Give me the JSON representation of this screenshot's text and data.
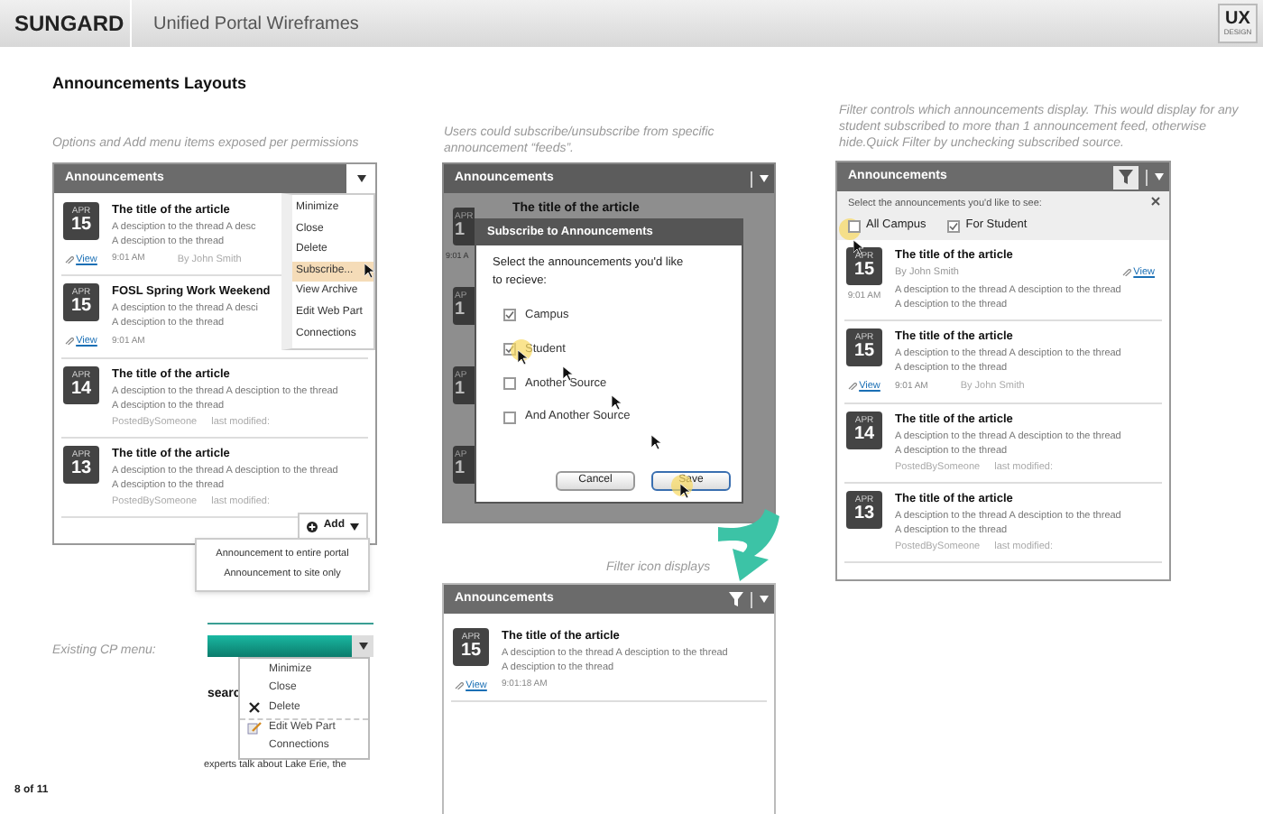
{
  "header": {
    "brand": "SUNGARD",
    "title": "Unified Portal Wireframes",
    "logo": "UX",
    "logo_sub": "DESIGN"
  },
  "page_title": "Announcements Layouts",
  "panel_options": {
    "caption": "Options and Add menu items exposed per permissions",
    "portlet_title": "Announcements",
    "articles": [
      {
        "kind": "footer",
        "month": "APR",
        "day": "15",
        "title": "The title of the article",
        "lines": [
          "A desciption to the thread A desc",
          "A desciption to the thread"
        ],
        "view": "View",
        "time": "9:01 AM",
        "author": "By John Smith"
      },
      {
        "kind": "footer",
        "month": "APR",
        "day": "15",
        "title": "FOSL Spring Work Weekend",
        "lines": [
          "A desciption to the thread A desci",
          "A desciption to the thread"
        ],
        "view": "View",
        "time": "9:01 AM"
      },
      {
        "kind": "footer",
        "month": "APR",
        "day": "14",
        "title": "The title of the article",
        "lines": [
          "A desciption to the thread A desciption to the thread",
          "A desciption to the thread"
        ],
        "posted_by": "PostedBySomeone",
        "last_modified": "last modified:"
      },
      {
        "kind": "footer",
        "month": "APR",
        "day": "13",
        "title": "The title of the article",
        "lines": [
          "A desciption to the thread A desciption to the thread",
          "A desciption to the thread"
        ],
        "posted_by": "PostedBySomeone",
        "last_modified": "last modified:"
      }
    ],
    "menu": [
      {
        "label": "Minimize",
        "selected": false
      },
      {
        "label": "Close",
        "selected": false
      },
      {
        "label": "Delete",
        "selected": false
      },
      {
        "label": "Subscribe...",
        "selected": true
      },
      {
        "label": "View Archive",
        "selected": false
      },
      {
        "label": "Edit Web Part",
        "selected": false
      },
      {
        "label": "Connections",
        "selected": false
      }
    ],
    "add_button": "Add",
    "add_menu": [
      "Announcement to entire portal",
      "Announcement to site only"
    ]
  },
  "cp_menu": {
    "caption": "Existing CP menu:",
    "items": [
      {
        "label": "Minimize",
        "kind": "plain",
        "separator_before": false
      },
      {
        "label": "Close",
        "kind": "plain",
        "separator_before": false
      },
      {
        "label": "Delete",
        "kind": "delete",
        "separator_before": false
      },
      {
        "label": "Edit Web Part",
        "kind": "edit",
        "separator_before": true
      },
      {
        "label": "Connections",
        "kind": "plain",
        "separator_before": false
      }
    ],
    "fragment_heading": "searc",
    "fragment_text": "experts talk about Lake Erie, the"
  },
  "page_number": "8 of 11",
  "panel_subscribe": {
    "caption": "Users could subscribe/unsubscribe from specific announcement “feeds”.",
    "portlet_title": "Announcements",
    "background": {
      "title": "The title of the article",
      "time": "9:01 A",
      "badges": [
        {
          "month": "APR",
          "day": "1"
        },
        {
          "month": "AP",
          "day": "1"
        },
        {
          "month": "AP",
          "day": "1"
        },
        {
          "month": "AP",
          "day": "1"
        }
      ]
    },
    "dialog": {
      "title": "Subscribe to Announcements",
      "prompt": "Select the announcements you'd like to recieve:",
      "options": [
        {
          "label": "Campus",
          "checked": true
        },
        {
          "label": "Student",
          "checked": true
        },
        {
          "label": "Another Source",
          "checked": false
        },
        {
          "label": "And Another Source",
          "checked": false
        }
      ],
      "buttons": [
        {
          "label": "Cancel",
          "primary": false
        },
        {
          "label": "Save",
          "primary": true
        }
      ]
    }
  },
  "panel_filter_icon": {
    "caption": "Filter icon displays",
    "portlet_title": "Announcements",
    "articles": [
      {
        "kind": "footer",
        "month": "APR",
        "day": "15",
        "title": "The title of the article",
        "lines": [
          "A desciption to the thread A desciption to the thread",
          "A desciption to the thread"
        ],
        "view": "View",
        "time": "9:01:18 AM"
      }
    ]
  },
  "panel_filter": {
    "caption": "Filter controls which announcements display.  This would display for any student subscribed to more than 1 announcement feed, otherwise hide.Quick Filter by unchecking subscribed source.",
    "portlet_title": "Announcements",
    "filter": {
      "prompt": "Select the announcements you'd like to see:",
      "options": [
        {
          "label": "All Campus",
          "checked": false
        },
        {
          "label": "For Student",
          "checked": true
        }
      ]
    },
    "articles": [
      {
        "kind": "side",
        "month": "APR",
        "day": "15",
        "title": "The title of the article",
        "byline": "By John Smith",
        "view": "View",
        "lines": [
          "A desciption to the thread A desciption to the thread",
          "A desciption to the thread"
        ],
        "time": "9:01 AM"
      },
      {
        "kind": "footer",
        "month": "APR",
        "day": "15",
        "title": "The title of the article",
        "lines": [
          "A desciption to the thread A desciption to the thread",
          "A desciption to the thread"
        ],
        "view": "View",
        "time": "9:01 AM",
        "author": "By John Smith"
      },
      {
        "kind": "footer",
        "month": "APR",
        "day": "14",
        "title": "The title of the article",
        "lines": [
          "A desciption to the thread A desciption to the thread",
          "A desciption to the thread"
        ],
        "posted_by": "PostedBySomeone",
        "last_modified": "last modified:"
      },
      {
        "kind": "footer",
        "month": "APR",
        "day": "13",
        "title": "The title of the article",
        "lines": [
          "A desciption to the thread A desciption to the thread",
          "A desciption to the thread"
        ],
        "posted_by": "PostedBySomeone",
        "last_modified": "last modified:"
      }
    ]
  }
}
